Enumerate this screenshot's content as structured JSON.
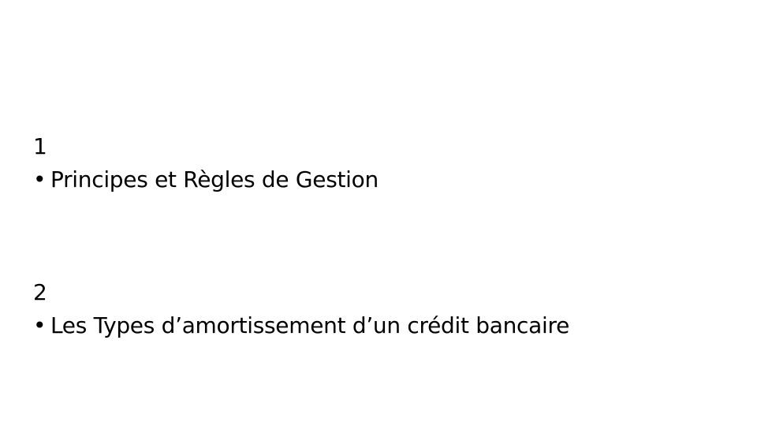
{
  "sections": [
    {
      "number": "1",
      "bullet": "•",
      "text": "Principes et Règles de Gestion"
    },
    {
      "number": "2",
      "bullet": "•",
      "text": "Les Types d’amortissement d’un crédit bancaire"
    }
  ]
}
